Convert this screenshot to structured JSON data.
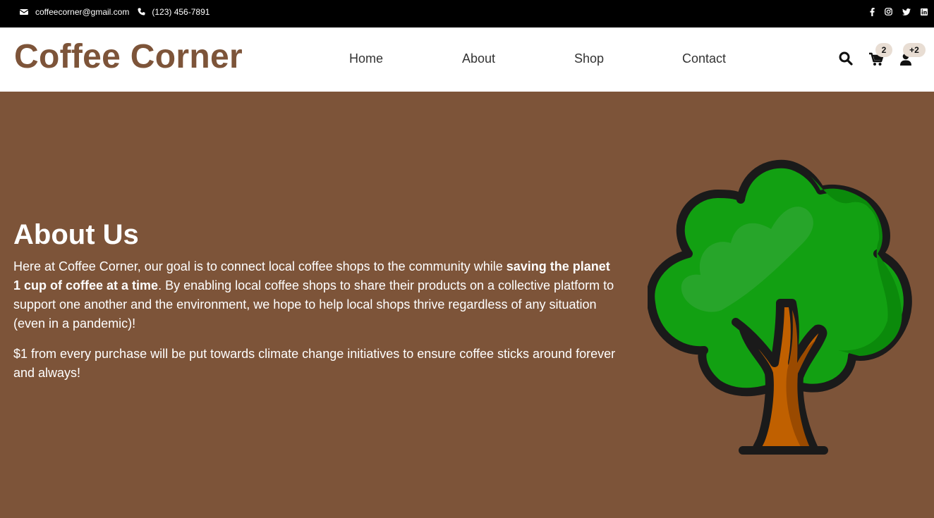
{
  "topbar": {
    "email": "coffeecorner@gmail.com",
    "phone": "(123) 456-7891",
    "social_icons": [
      "facebook-icon",
      "instagram-icon",
      "twitter-icon",
      "linkedin-icon"
    ]
  },
  "header": {
    "brand": "Coffee Corner",
    "nav": [
      {
        "label": "Home"
      },
      {
        "label": "About"
      },
      {
        "label": "Shop"
      },
      {
        "label": "Contact"
      }
    ],
    "cart_count": "2",
    "user_badge": "+2",
    "icons": [
      "search-icon",
      "cart-icon",
      "user-icon"
    ]
  },
  "hero": {
    "title": "About Us",
    "p1_a": "Here at Coffee Corner, our goal is to connect local coffee shops to the community while ",
    "p1_bold": "saving the planet 1 cup of coffee at a time",
    "p1_b": ". By enabling local coffee shops to share their products on a collective platform to support one another and the environment, we hope to help local shops thrive regardless of any situation (even in a pandemic)!",
    "p2": "$1 from every purchase will be put towards climate change initiatives to ensure coffee sticks around forever and always!",
    "illustration": "tree-illustration"
  },
  "colors": {
    "brand_brown": "#7d5439",
    "topbar_bg": "#000000",
    "badge_bg": "#e8ddd3",
    "tree_green": "#12a012",
    "trunk_orange": "#c06000"
  }
}
